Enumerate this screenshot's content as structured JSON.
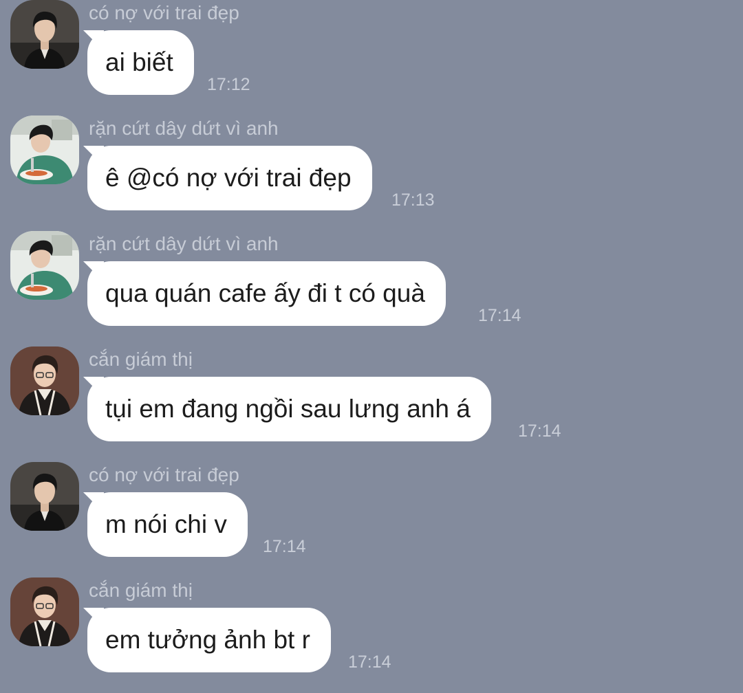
{
  "messages": [
    {
      "sender": "có nợ với trai đẹp",
      "text": "ai biết",
      "time": "17:12",
      "avatar": "avatar-young-man-black-jacket"
    },
    {
      "sender": "rặn cứt dây dứt vì anh",
      "text": "ê @có nợ với trai đẹp",
      "time": "17:13",
      "avatar": "avatar-man-eating-green-sweater"
    },
    {
      "sender": "rặn cứt dây dứt vì anh",
      "text": "qua quán cafe ấy đi t có quà",
      "time": "17:14",
      "avatar": "avatar-man-eating-green-sweater"
    },
    {
      "sender": "cắn giám thị",
      "text": "tụi em đang ngồi sau lưng anh á",
      "time": "17:14",
      "avatar": "avatar-man-glasses-varsity-jacket"
    },
    {
      "sender": "có nợ với trai đẹp",
      "text": "m nói chi v",
      "time": "17:14",
      "avatar": "avatar-young-man-black-jacket"
    },
    {
      "sender": "cắn giám thị",
      "text": "em tưởng ảnh bt r",
      "time": "17:14",
      "avatar": "avatar-man-glasses-varsity-jacket"
    }
  ],
  "colors": {
    "background": "#838b9d",
    "bubble": "#ffffff",
    "sender_text": "#c7ccd6",
    "time_text": "#c9ced8"
  }
}
